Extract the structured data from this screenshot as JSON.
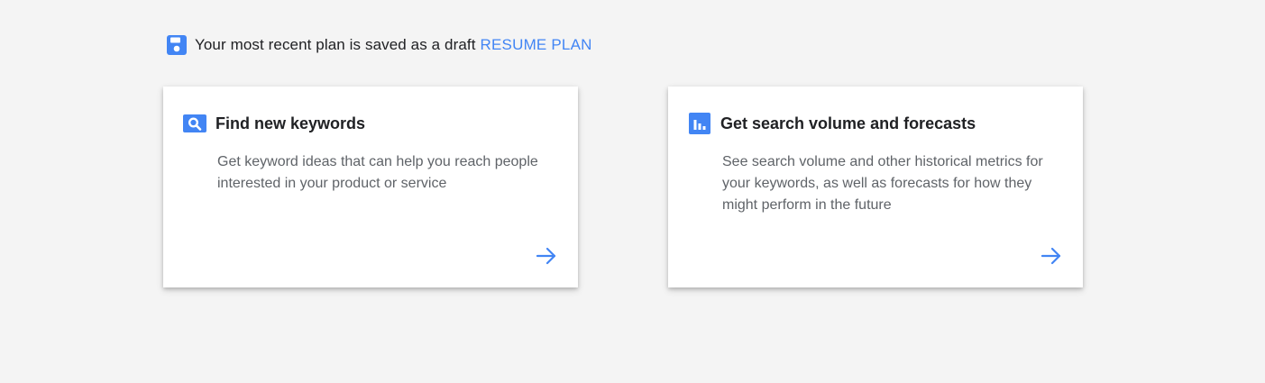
{
  "draft_banner": {
    "icon": "save-icon",
    "message": "Your most recent plan is saved as a draft",
    "link_label": "RESUME PLAN"
  },
  "cards": [
    {
      "icon": "search-icon",
      "title": "Find new keywords",
      "description": "Get keyword ideas that can help you reach people interested in your product or service",
      "arrow_icon": "arrow-right-icon"
    },
    {
      "icon": "bar-chart-icon",
      "title": "Get search volume and forecasts",
      "description": "See search volume and other historical metrics for your keywords, as well as forecasts for how they might perform in the future",
      "arrow_icon": "arrow-right-icon"
    }
  ],
  "colors": {
    "accent": "#4285f4",
    "background": "#f4f4f4",
    "card": "#ffffff",
    "title_text": "#202124",
    "body_text": "#5f6368"
  }
}
